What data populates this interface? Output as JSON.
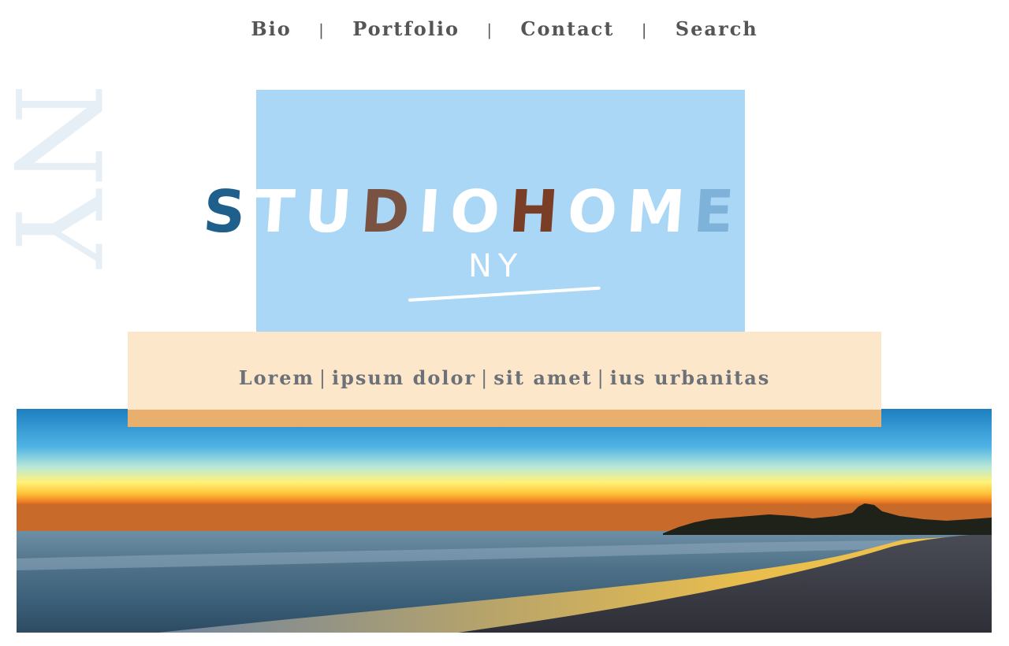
{
  "watermark": "NY",
  "nav": {
    "items": [
      "Bio",
      "Portfolio",
      "Contact",
      "Search"
    ],
    "separator": "|"
  },
  "logo": {
    "letters": [
      {
        "ch": "S",
        "color": "#1f5f8b"
      },
      {
        "ch": "T",
        "color": "#ffffff"
      },
      {
        "ch": "U",
        "color": "#ffffff"
      },
      {
        "ch": "D",
        "color": "#7a5242"
      },
      {
        "ch": "I",
        "color": "#ffffff"
      },
      {
        "ch": "O",
        "color": "#ffffff"
      },
      {
        "ch": "H",
        "color": "#7a3e26"
      },
      {
        "ch": "O",
        "color": "#ffffff"
      },
      {
        "ch": "M",
        "color": "#ffffff"
      },
      {
        "ch": "E",
        "color": "#7fb2d9"
      }
    ],
    "sub": "NY"
  },
  "tagline": {
    "items": [
      "Lorem",
      "ipsum dolor",
      "sit amet",
      "ius urbanitas"
    ],
    "separator": "|"
  },
  "colors": {
    "logo_box": "#a9d7f5",
    "tagline_bg": "#fde7cb",
    "tagline_accent": "#e8b06c"
  },
  "banner": {
    "subject": "beach-sunset-photo"
  }
}
